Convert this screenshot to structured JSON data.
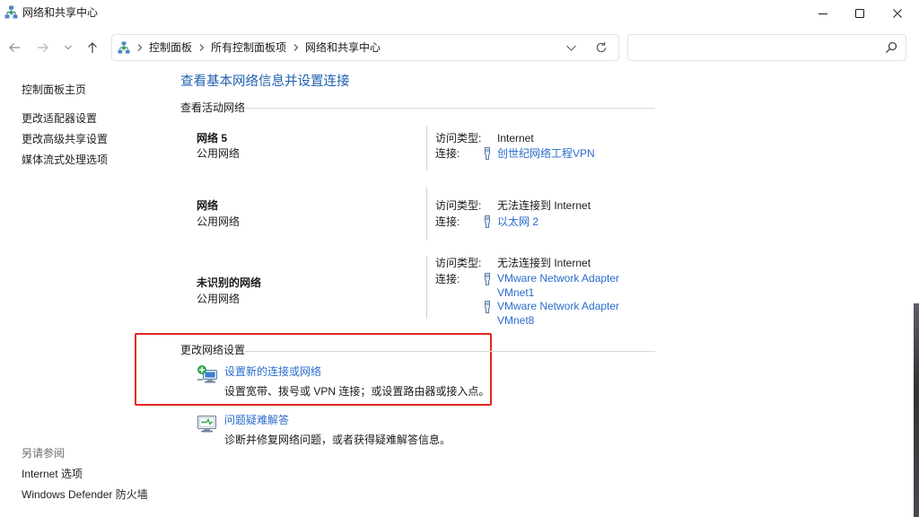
{
  "window": {
    "title": "网络和共享中心",
    "icon": "network-sharing-center-icon",
    "controls": {
      "minimize_icon": "minimize-icon",
      "maximize_icon": "maximize-icon",
      "close_icon": "close-icon"
    }
  },
  "toolbar": {
    "back_icon": "arrow-left-icon",
    "forward_icon": "arrow-right-icon",
    "recent_icon": "chevron-down-icon",
    "up_icon": "arrow-up-icon"
  },
  "address_bar": {
    "location_icon": "network-sharing-center-icon",
    "separator_icon": "chevron-right-icon",
    "crumbs": [
      "控制面板",
      "所有控制面板项",
      "网络和共享中心"
    ],
    "dropdown_icon": "chevron-down-icon",
    "refresh_icon": "refresh-icon"
  },
  "search": {
    "value": "",
    "icon": "search-icon"
  },
  "sidebar": {
    "links": [
      "控制面板主页",
      "更改适配器设置",
      "更改高级共享设置",
      "媒体流式处理选项"
    ]
  },
  "see_also": {
    "heading": "另请参阅",
    "links": [
      "Internet 选项",
      "Windows Defender 防火墙"
    ]
  },
  "main": {
    "title": "查看基本网络信息并设置连接",
    "active_networks": {
      "heading": "查看活动网络",
      "networks": [
        {
          "name": "网络 5",
          "category": "公用网络",
          "access_label": "访问类型:",
          "access_type": "Internet",
          "connections_label": "连接:",
          "connections": [
            {
              "label": "创世纪网络工程VPN",
              "icon": "ethernet-plug-icon"
            }
          ]
        },
        {
          "name": "网络",
          "category": "公用网络",
          "access_label": "访问类型:",
          "access_type": "无法连接到 Internet",
          "connections_label": "连接:",
          "connections": [
            {
              "label": "以太网 2",
              "icon": "ethernet-plug-icon"
            }
          ]
        },
        {
          "name": "未识别的网络",
          "category": "公用网络",
          "access_label": "访问类型:",
          "access_type": "无法连接到 Internet",
          "connections_label": "连接:",
          "connections": [
            {
              "label": "VMware Network Adapter VMnet1",
              "icon": "ethernet-plug-icon"
            },
            {
              "label": "VMware Network Adapter VMnet8",
              "icon": "ethernet-plug-icon"
            }
          ]
        }
      ]
    },
    "change_settings": {
      "heading": "更改网络设置",
      "tasks": [
        {
          "label": "设置新的连接或网络",
          "description": "设置宽带、拨号或 VPN 连接；或设置路由器或接入点。",
          "icon": "new-connection-icon"
        },
        {
          "label": "问题疑难解答",
          "description": "诊断并修复网络问题，或者获得疑难解答信息。",
          "icon": "troubleshoot-icon"
        }
      ]
    }
  },
  "colors": {
    "link": "#2a6ccc",
    "heading": "#1f5fae",
    "text": "#1a1a1a",
    "muted": "#6d6d6d",
    "divider": "#d9d9d9",
    "highlight_border": "#e3261f",
    "nav_link": "#1f1f1f"
  }
}
